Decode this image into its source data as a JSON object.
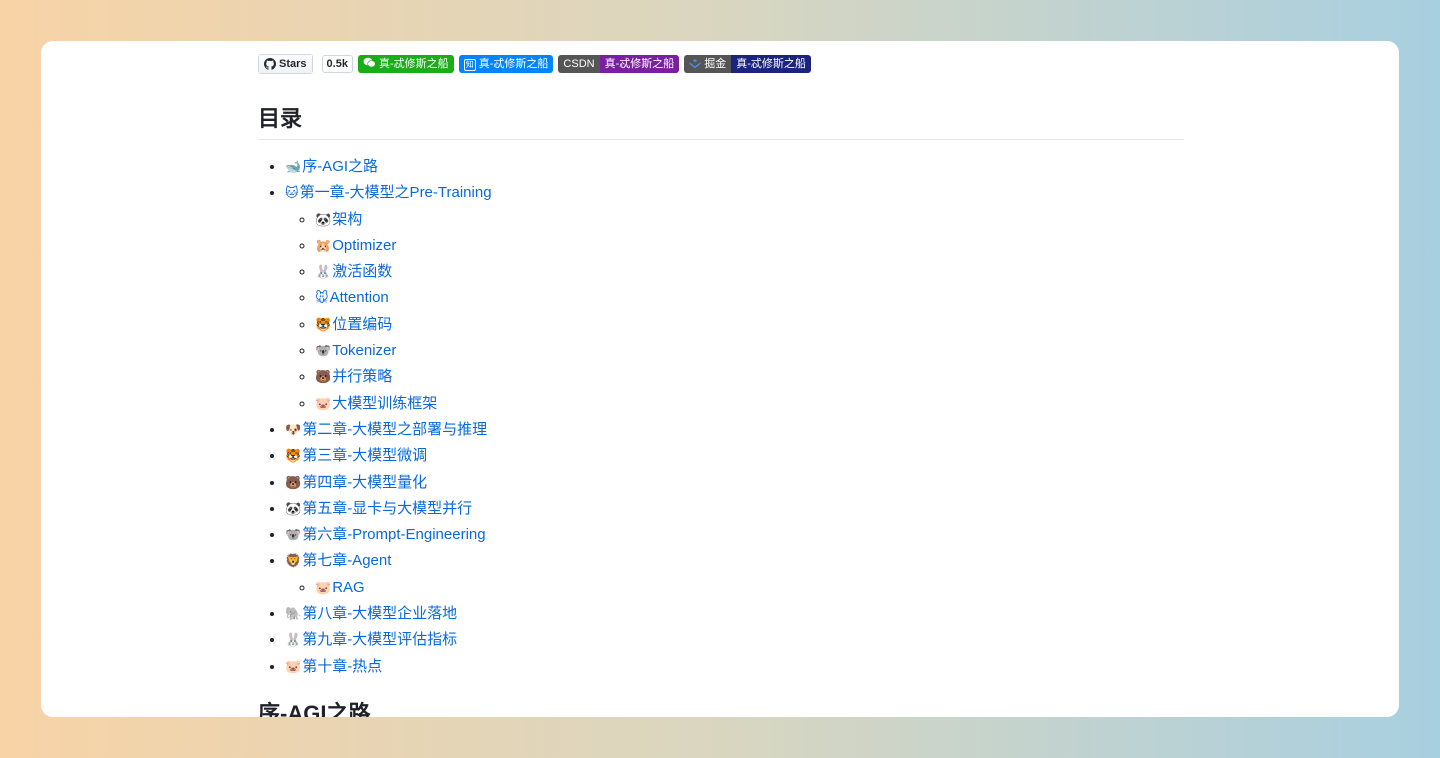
{
  "badges": {
    "github_label": "Stars",
    "github_count": "0.5k",
    "wechat_text": "真-忒修斯之船",
    "zhihu_icon": "知",
    "zhihu_text": "真-忒修斯之船",
    "csdn_label": "CSDN",
    "csdn_text": "真-忒修斯之船",
    "juejin_label": "掘金",
    "juejin_text": "真-忒修斯之船",
    "colors": {
      "wechat": "#1aad19",
      "zhihu": "#0084ff",
      "csdn": "#7a1fa2",
      "juejin": "#1a237e"
    }
  },
  "toc_title": "目录",
  "toc": [
    {
      "emoji": "🐋",
      "label": "序-AGI之路"
    },
    {
      "emoji": "🐱",
      "label": "第一章-大模型之Pre-Training",
      "children": [
        {
          "emoji": "🐼",
          "label": "架构"
        },
        {
          "emoji": "🐹",
          "label": "Optimizer"
        },
        {
          "emoji": "🐰",
          "label": "激活函数"
        },
        {
          "emoji": "🐭",
          "label": "Attention"
        },
        {
          "emoji": "🐯",
          "label": "位置编码"
        },
        {
          "emoji": "🐨",
          "label": "Tokenizer"
        },
        {
          "emoji": "🐻",
          "label": "并行策略"
        },
        {
          "emoji": "🐷",
          "label": "大模型训练框架"
        }
      ]
    },
    {
      "emoji": "🐶",
      "label": "第二章-大模型之部署与推理"
    },
    {
      "emoji": "🐯",
      "label": "第三章-大模型微调"
    },
    {
      "emoji": "🐻",
      "label": "第四章-大模型量化"
    },
    {
      "emoji": "🐼",
      "label": "第五章-显卡与大模型并行"
    },
    {
      "emoji": "🐨",
      "label": "第六章-Prompt-Engineering"
    },
    {
      "emoji": "🦁",
      "label": "第七章-Agent",
      "children": [
        {
          "emoji": "🐷",
          "label": "RAG"
        }
      ]
    },
    {
      "emoji": "🐘",
      "label": "第八章-大模型企业落地"
    },
    {
      "emoji": "🐰",
      "label": "第九章-大模型评估指标"
    },
    {
      "emoji": "🐷",
      "label": "第十章-热点"
    }
  ],
  "section_title": "序-AGI之路",
  "link_color": "#0969da"
}
